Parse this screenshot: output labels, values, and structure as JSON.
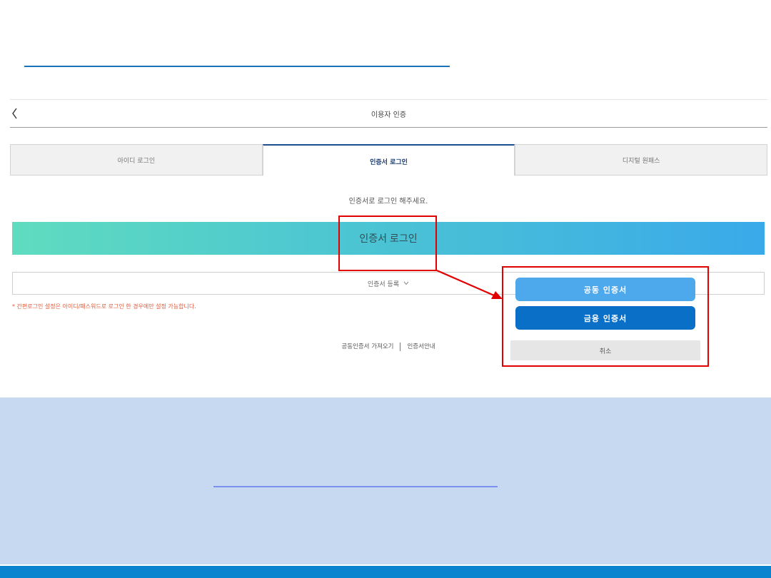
{
  "header": {
    "title": "이용자 인증",
    "back_icon": "chevron-left-icon"
  },
  "tabs": [
    {
      "label": "아이디 로그인",
      "active": false
    },
    {
      "label": "인증서 로그인",
      "active": true
    },
    {
      "label": "디지털 원패스",
      "active": false
    }
  ],
  "instruction": "인증서로 로그인 해주세요.",
  "cert_login_label": "인증서 로그인",
  "cert_register_label": "인증서 등록",
  "notice": "* 간편로그인 설정은 아이디/패스워드로 로그인 한 경우에만 설정 가능합니다.",
  "links": {
    "import": "공동인증서 가져오기",
    "guide": "인증서안내"
  },
  "popup": {
    "joint_cert": "공동 인증서",
    "finance_cert": "금융 인증서",
    "cancel": "취소"
  },
  "colors": {
    "highlight": "#e00000",
    "joint_button": "#4ea8ec",
    "finance_button": "#0a70c7",
    "lower_panel": "#c7d9f0",
    "bottom_bar": "#0b84d0"
  }
}
